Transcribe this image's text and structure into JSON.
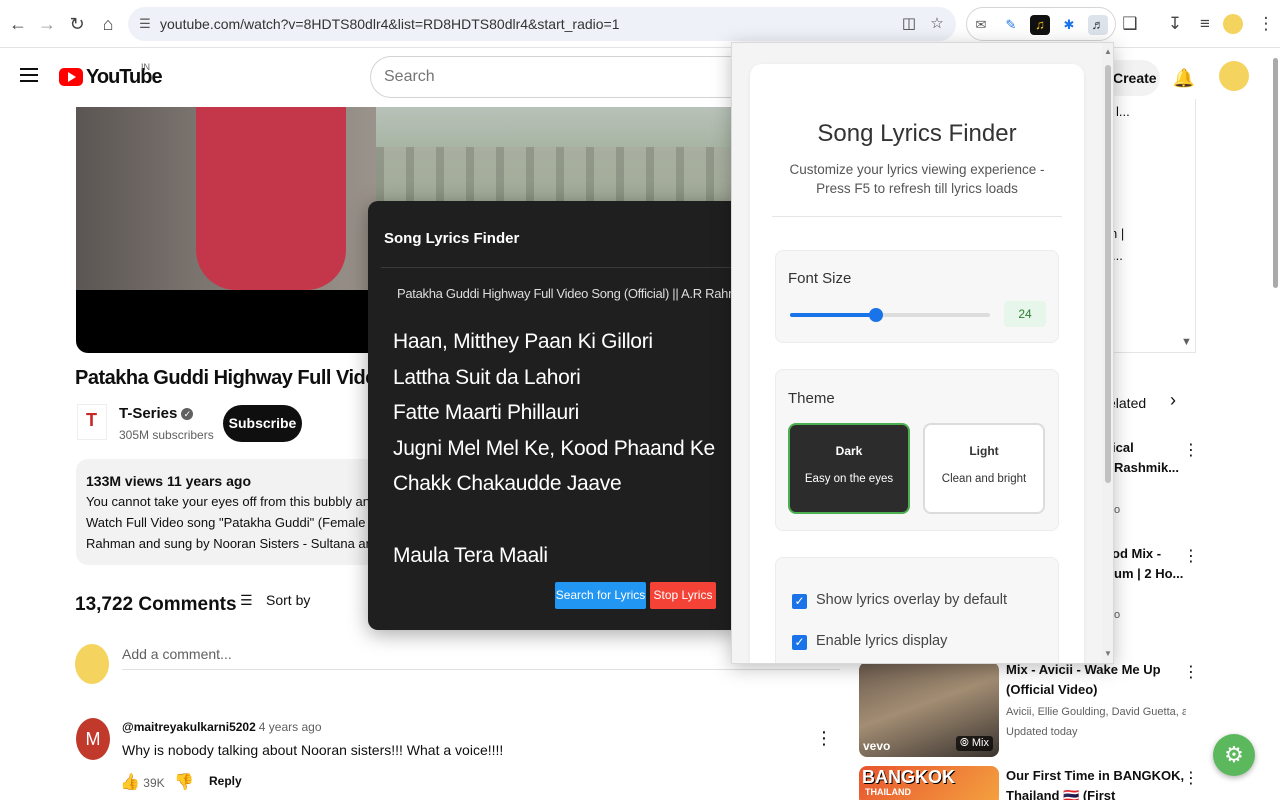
{
  "browser": {
    "url": "youtube.com/watch?v=8HDTS80dlr4&list=RD8HDTS80dlr4&start_radio=1",
    "icons": [
      "back-icon",
      "forward-icon",
      "reload-icon",
      "home-icon",
      "site-info-icon",
      "install-icon",
      "star-icon",
      "mail-icon",
      "pen-icon",
      "extension-icon",
      "puzzle-icon",
      "lyrics-ext-icon",
      "extensions-icon",
      "download-icon",
      "media-icon",
      "profile-icon",
      "menu-icon"
    ]
  },
  "youtube": {
    "country": "IN",
    "search_placeholder": "Search",
    "create_label": "Create",
    "video": {
      "title": "Patakha Guddi Highway Full Video Song",
      "channel": "T-Series",
      "subscribers": "305M subscribers",
      "subscribe_label": "Subscribe",
      "views_time": "133M views  11 years ago",
      "desc_lines": [
        "You cannot take your eyes off from this bubbly and bin",
        "Watch Full Video song \"Patakha Guddi\" (Female Versio",
        "Rahman and sung by Nooran Sisters - Sultana and Jyo"
      ]
    },
    "comments": {
      "count": "13,722 Comments",
      "sort_label": "Sort by",
      "add_placeholder": "Add a comment...",
      "items": [
        {
          "initial": "M",
          "user": "@maitreyakulkarni5202",
          "time": "4 years ago",
          "text": "Why is nobody talking about Nooran sisters!!! What a voice!!!!",
          "likes": "39K",
          "reply_label": "Reply"
        }
      ]
    },
    "right_fragments": {
      "top": [
        "l...",
        "n |",
        "..."
      ],
      "related_tab": "elated",
      "item1": [
        "ical",
        "Rashmik..."
      ],
      "item1_sub": "o",
      "item2": [
        "od Mix -",
        "um | 2 Ho..."
      ],
      "item2_sub": "o"
    },
    "related": [
      {
        "title": "Mix - Avicii - Wake Me Up (Official Video)",
        "sub1": "Avicii, Ellie Goulding, David Guetta, and ...",
        "sub2": "Updated today",
        "badge": "Mix",
        "brand": "vevo"
      },
      {
        "title": "Our First Time in BANGKOK, Thailand 🇹🇭 (First Impressions)",
        "thumb_text": "BANGKOK",
        "thumb_sub": "THAILAND"
      }
    ]
  },
  "overlay": {
    "header": "Song Lyrics Finder",
    "song": "Patakha Guddi Highway Full Video Song (Official) || A.R Rahman ||",
    "lyrics": [
      "Haan, Mitthey Paan Ki Gillori",
      "Lattha Suit da Lahori",
      "Fatte Maarti Phillauri",
      "Jugni Mel Mel Ke, Kood Phaand Ke",
      "Chakk Chakaudde Jaave",
      "",
      "Maula Tera Maali"
    ],
    "search_label": "Search for Lyrics",
    "stop_label": "Stop Lyrics",
    "colors": {
      "bg": "#1f1f1f",
      "search": "#2196f3",
      "stop": "#f44336"
    }
  },
  "popup": {
    "title": "Song Lyrics Finder",
    "subtitle": "Customize your lyrics viewing experience - Press F5 to refresh till lyrics loads",
    "font_size": {
      "label": "Font Size",
      "value": "24",
      "level": 0.43
    },
    "theme": {
      "label": "Theme",
      "options": [
        {
          "name": "Dark",
          "desc": "Easy on the eyes",
          "selected": true
        },
        {
          "name": "Light",
          "desc": "Clean and bright",
          "selected": false
        }
      ]
    },
    "options": [
      {
        "label": "Show lyrics overlay by default",
        "checked": true
      },
      {
        "label": "Enable lyrics display",
        "checked": true
      }
    ],
    "accent": "#1a73e8",
    "selected_border": "#4caf50"
  }
}
